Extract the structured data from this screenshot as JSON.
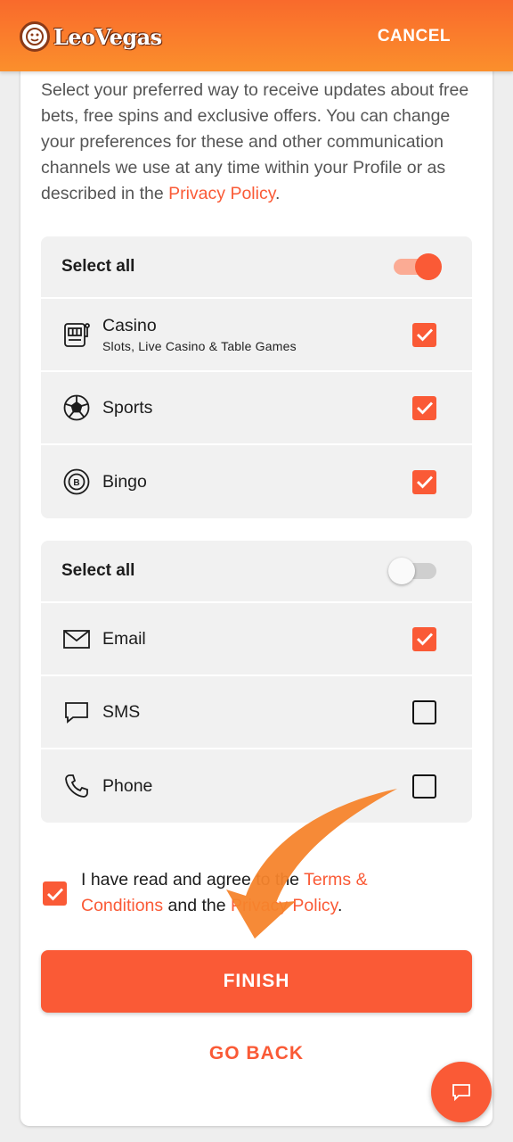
{
  "header": {
    "brand": "LeoVegas",
    "cancel_label": "CANCEL"
  },
  "intro": {
    "text": "Select your preferred way to receive updates about free bets, free spins and exclusive offers. You can change your preferences for these and other communication channels we use at any time within your Profile or as described in the ",
    "link": "Privacy Policy",
    "end": "."
  },
  "products": {
    "select_all_label": "Select all",
    "select_all_on": true,
    "items": [
      {
        "label": "Casino",
        "sub": "Slots, Live Casino & Table Games",
        "icon": "slot-machine-icon",
        "checked": true
      },
      {
        "label": "Sports",
        "icon": "football-icon",
        "checked": true
      },
      {
        "label": "Bingo",
        "icon": "bingo-ball-icon",
        "checked": true
      }
    ]
  },
  "channels": {
    "select_all_label": "Select all",
    "select_all_on": false,
    "items": [
      {
        "label": "Email",
        "icon": "envelope-icon",
        "checked": true
      },
      {
        "label": "SMS",
        "icon": "chat-bubble-icon",
        "checked": false
      },
      {
        "label": "Phone",
        "icon": "phone-icon",
        "checked": false
      }
    ]
  },
  "terms": {
    "checked": true,
    "text_1": "I have read and agree to the ",
    "terms_link": "Terms & Conditions",
    "text_2": " and the ",
    "privacy_link": "Privacy Policy",
    "text_3": "."
  },
  "actions": {
    "finish_label": "FINISH",
    "go_back_label": "GO BACK"
  },
  "colors": {
    "accent": "#fa5a36",
    "header_top": "#f96a2c",
    "header_bottom": "#fb8f2c",
    "annotation_arrow": "#f6842c"
  }
}
